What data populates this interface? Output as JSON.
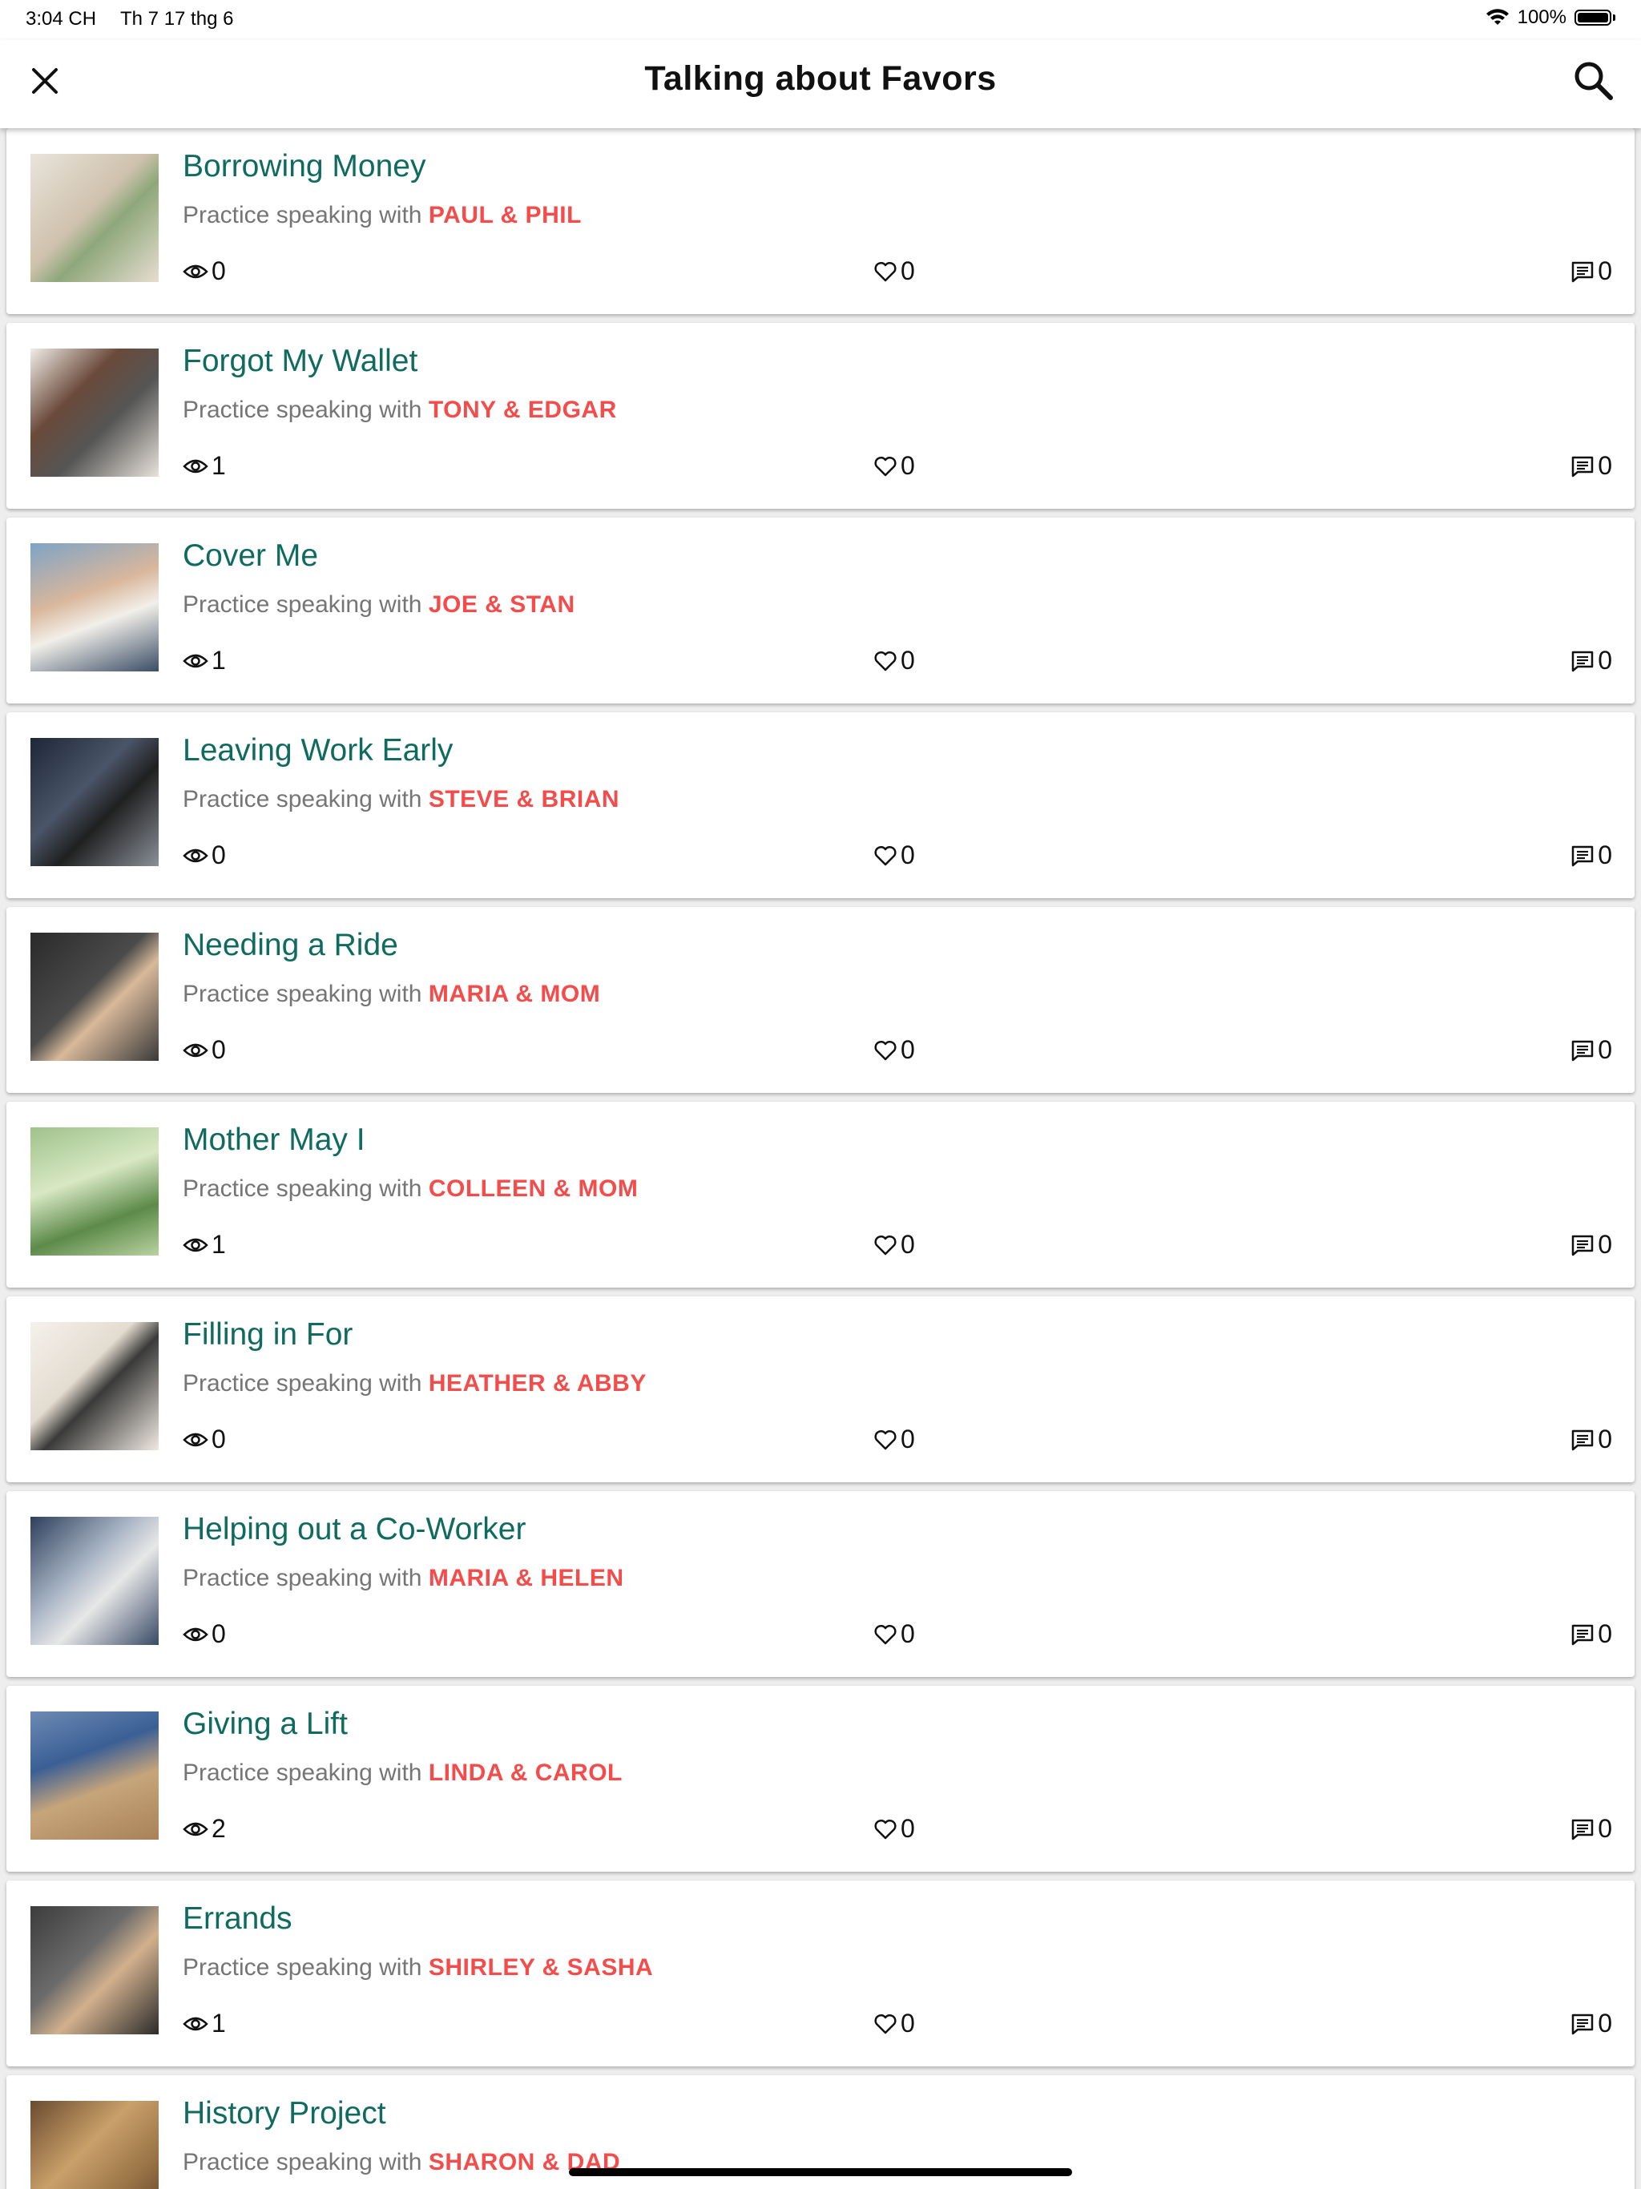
{
  "status_bar": {
    "time": "3:04 CH",
    "date": "Th 7 17 thg 6",
    "battery": "100%"
  },
  "header": {
    "title": "Talking about Favors"
  },
  "subtitle_prefix": "Practice speaking with",
  "lessons": [
    {
      "title": "Borrowing Money",
      "speakers": "PAUL & PHIL",
      "views": "0",
      "likes": "0",
      "comments": "0"
    },
    {
      "title": "Forgot My Wallet",
      "speakers": "TONY & EDGAR",
      "views": "1",
      "likes": "0",
      "comments": "0"
    },
    {
      "title": "Cover Me",
      "speakers": "JOE & STAN",
      "views": "1",
      "likes": "0",
      "comments": "0"
    },
    {
      "title": "Leaving Work Early",
      "speakers": "STEVE & BRIAN",
      "views": "0",
      "likes": "0",
      "comments": "0"
    },
    {
      "title": "Needing a Ride",
      "speakers": "MARIA & MOM",
      "views": "0",
      "likes": "0",
      "comments": "0"
    },
    {
      "title": "Mother May I",
      "speakers": "COLLEEN & MOM",
      "views": "1",
      "likes": "0",
      "comments": "0"
    },
    {
      "title": "Filling in For",
      "speakers": "HEATHER & ABBY",
      "views": "0",
      "likes": "0",
      "comments": "0"
    },
    {
      "title": "Helping out a Co-Worker",
      "speakers": "MARIA & HELEN",
      "views": "0",
      "likes": "0",
      "comments": "0"
    },
    {
      "title": "Giving a Lift",
      "speakers": "LINDA & CAROL",
      "views": "2",
      "likes": "0",
      "comments": "0"
    },
    {
      "title": "Errands",
      "speakers": "SHIRLEY & SASHA",
      "views": "1",
      "likes": "0",
      "comments": "0"
    },
    {
      "title": "History Project",
      "speakers": "SHARON & DAD",
      "views": "",
      "likes": "",
      "comments": ""
    }
  ],
  "colors": {
    "title": "#0f6b5f",
    "speakers": "#f44b4b",
    "subtitle": "#757575"
  }
}
